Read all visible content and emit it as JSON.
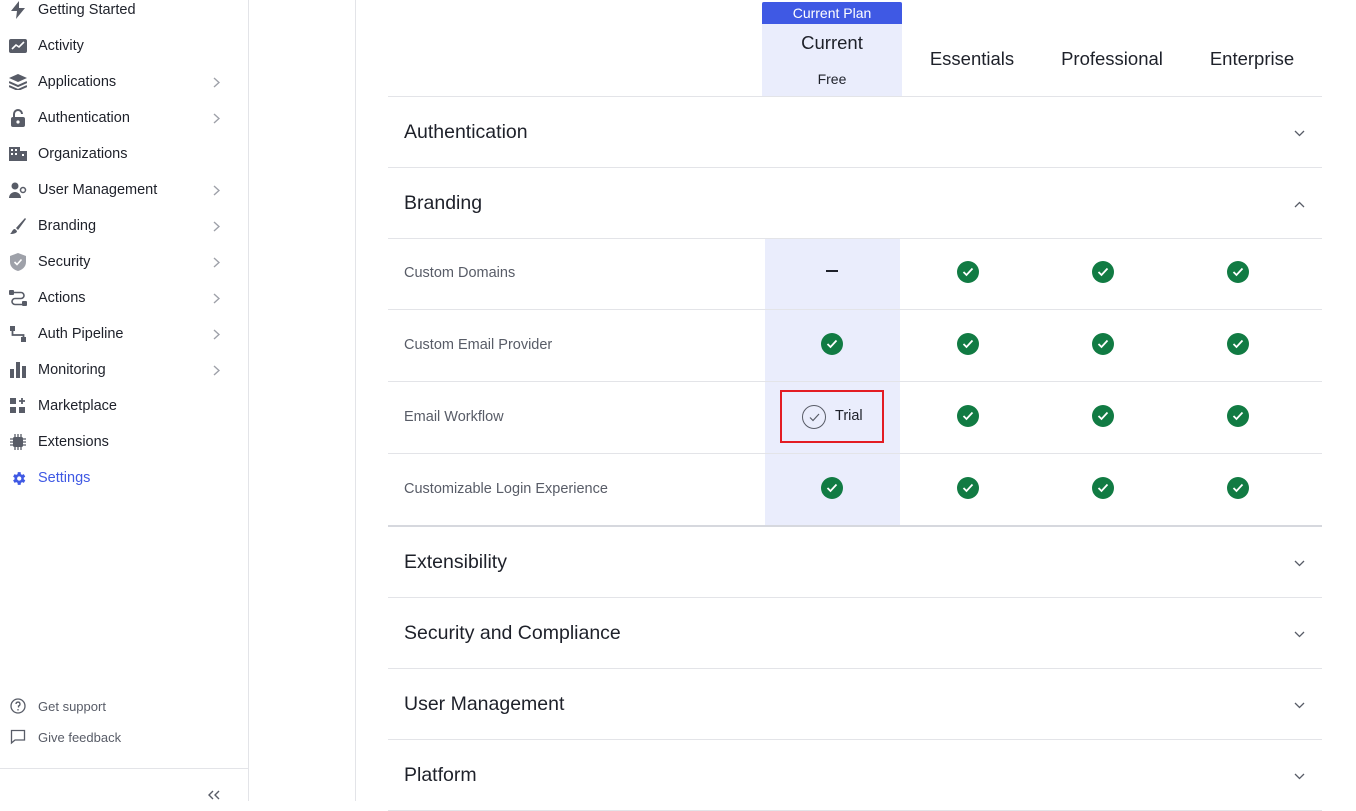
{
  "sidebar": {
    "items": [
      {
        "label": "Getting Started",
        "icon": "bolt-icon",
        "chevron": false
      },
      {
        "label": "Activity",
        "icon": "activity-chart-icon",
        "chevron": false
      },
      {
        "label": "Applications",
        "icon": "layers-icon",
        "chevron": true
      },
      {
        "label": "Authentication",
        "icon": "lock-icon",
        "chevron": true
      },
      {
        "label": "Organizations",
        "icon": "building-icon",
        "chevron": false
      },
      {
        "label": "User Management",
        "icon": "users-icon",
        "chevron": true
      },
      {
        "label": "Branding",
        "icon": "brush-icon",
        "chevron": true
      },
      {
        "label": "Security",
        "icon": "shield-icon",
        "chevron": true
      },
      {
        "label": "Actions",
        "icon": "actions-flow-icon",
        "chevron": true
      },
      {
        "label": "Auth Pipeline",
        "icon": "pipeline-icon",
        "chevron": true
      },
      {
        "label": "Monitoring",
        "icon": "bar-chart-icon",
        "chevron": true
      },
      {
        "label": "Marketplace",
        "icon": "marketplace-grid-icon",
        "chevron": false
      },
      {
        "label": "Extensions",
        "icon": "chip-icon",
        "chevron": false
      },
      {
        "label": "Settings",
        "icon": "gear-icon",
        "chevron": false,
        "active": true
      }
    ],
    "footer": [
      {
        "label": "Get support",
        "icon": "help-circle-icon"
      },
      {
        "label": "Give feedback",
        "icon": "feedback-bubble-icon"
      }
    ]
  },
  "plans": {
    "current_tag": "Current Plan",
    "current_title": "Current",
    "current_subtitle": "Free",
    "names": [
      "Essentials",
      "Professional",
      "Enterprise"
    ]
  },
  "sections": {
    "authentication": "Authentication",
    "branding": "Branding",
    "extensibility": "Extensibility",
    "security": "Security and Compliance",
    "user_management": "User Management",
    "platform": "Platform"
  },
  "branding_features": [
    {
      "label": "Custom Domains",
      "current": "dash",
      "essentials": "check",
      "professional": "check",
      "enterprise": "check"
    },
    {
      "label": "Custom Email Provider",
      "current": "check",
      "essentials": "check",
      "professional": "check",
      "enterprise": "check"
    },
    {
      "label": "Email Workflow",
      "current": "trial",
      "essentials": "check",
      "professional": "check",
      "enterprise": "check"
    },
    {
      "label": "Customizable Login Experience",
      "current": "check",
      "essentials": "check",
      "professional": "check",
      "enterprise": "check"
    }
  ],
  "trial_label": "Trial",
  "colors": {
    "accent": "#3f59e4",
    "check": "#117b43",
    "highlight": "#e31c23",
    "current_bg": "#eaedfc"
  }
}
